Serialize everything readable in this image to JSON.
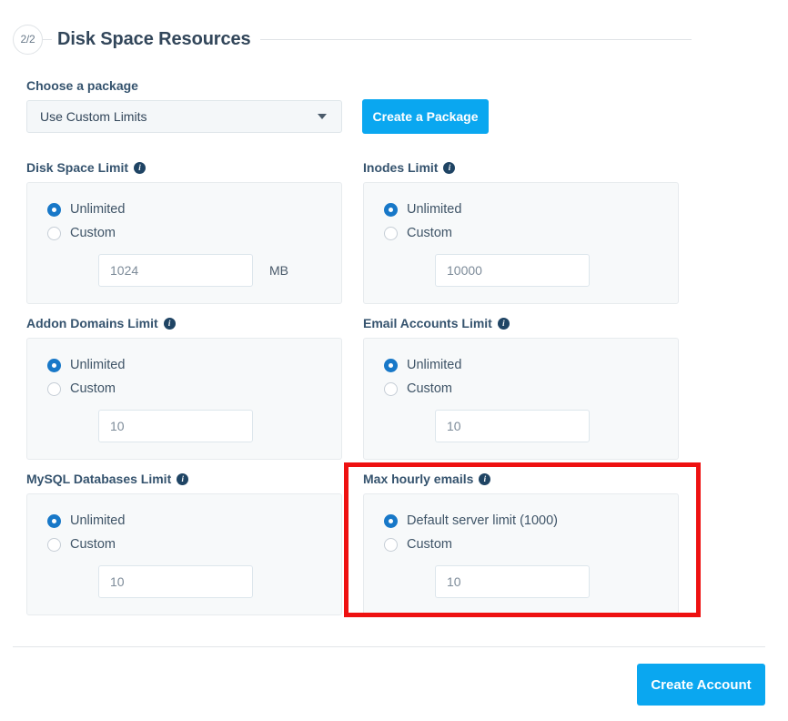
{
  "header": {
    "step_badge": "2/2",
    "title": "Disk Space Resources"
  },
  "package": {
    "label": "Choose a package",
    "selected": "Use Custom Limits",
    "caret_icon": "chevron-down-icon",
    "create_button": "Create a Package"
  },
  "info_icon_glyph": "i",
  "limits": [
    {
      "key": "disk-space",
      "label": "Disk Space Limit",
      "option_default": "Unlimited",
      "option_custom": "Custom",
      "selected": "default",
      "value": "1024",
      "unit": "MB"
    },
    {
      "key": "inodes",
      "label": "Inodes Limit",
      "option_default": "Unlimited",
      "option_custom": "Custom",
      "selected": "default",
      "value": "10000",
      "unit": ""
    },
    {
      "key": "addon-domains",
      "label": "Addon Domains Limit",
      "option_default": "Unlimited",
      "option_custom": "Custom",
      "selected": "default",
      "value": "10",
      "unit": ""
    },
    {
      "key": "email-accounts",
      "label": "Email Accounts Limit",
      "option_default": "Unlimited",
      "option_custom": "Custom",
      "selected": "default",
      "value": "10",
      "unit": ""
    },
    {
      "key": "mysql-databases",
      "label": "MySQL Databases Limit",
      "option_default": "Unlimited",
      "option_custom": "Custom",
      "selected": "default",
      "value": "10",
      "unit": ""
    },
    {
      "key": "max-hourly-emails",
      "label": "Max hourly emails",
      "option_default": "Default server limit (1000)",
      "option_custom": "Custom",
      "selected": "default",
      "value": "10",
      "unit": ""
    }
  ],
  "annotation": {
    "target": "max-hourly-emails",
    "color": "#ee1111"
  },
  "footer": {
    "submit_label": "Create Account"
  }
}
